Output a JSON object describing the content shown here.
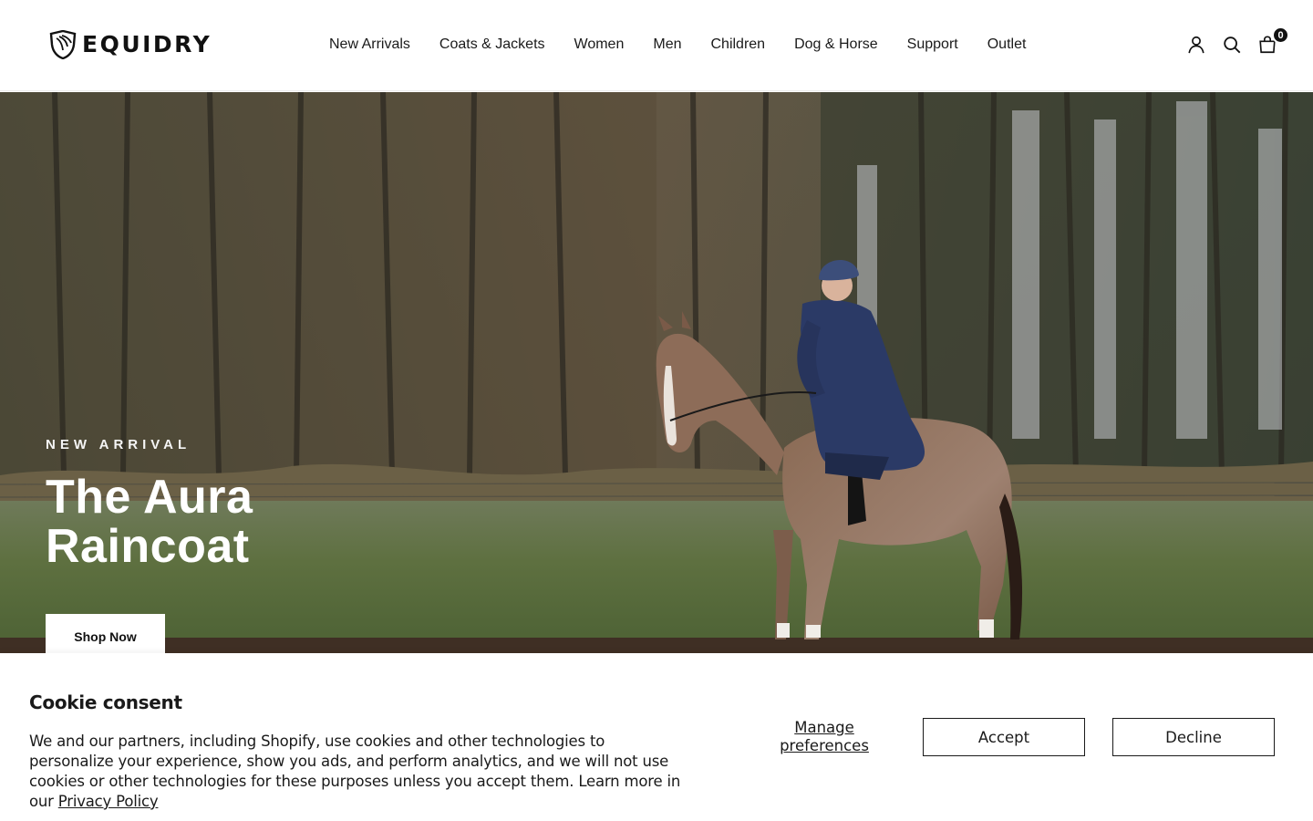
{
  "header": {
    "logo_text": "EQUIDRY",
    "nav": [
      {
        "label": "New Arrivals"
      },
      {
        "label": "Coats & Jackets"
      },
      {
        "label": "Women"
      },
      {
        "label": "Men"
      },
      {
        "label": "Children"
      },
      {
        "label": "Dog & Horse"
      },
      {
        "label": "Support"
      },
      {
        "label": "Outlet"
      }
    ],
    "icons": [
      "account-icon",
      "search-icon",
      "cart-icon"
    ],
    "cart_count": "0"
  },
  "hero": {
    "eyebrow": "NEW ARRIVAL",
    "title": "The Aura Raincoat",
    "button_label": "Shop Now"
  },
  "cookie": {
    "title": "Cookie consent",
    "text": "We and our partners, including Shopify, use cookies and other technologies to personalize your experience, show you ads, and perform analytics, and we will not use cookies or other technologies for these purposes unless you accept them. Learn more in our ",
    "link_label": "Privacy Policy",
    "manage_label": "Manage preferences",
    "accept_label": "Accept",
    "decline_label": "Decline"
  },
  "colors": {
    "accent": "#111111",
    "background": "#ffffff",
    "coat": "#2b3a66"
  }
}
